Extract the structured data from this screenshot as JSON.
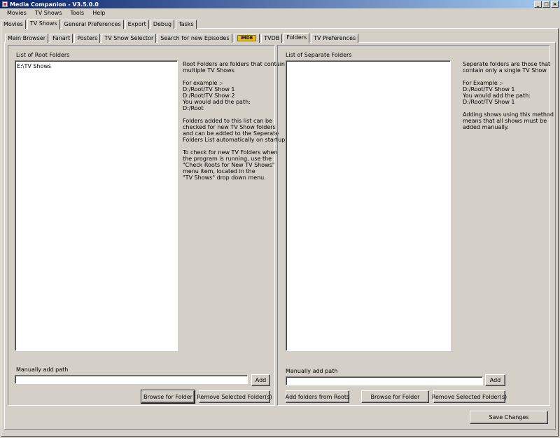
{
  "window": {
    "title": "Media Companion - V3.5.0.0"
  },
  "menu": [
    "Movies",
    "TV Shows",
    "Tools",
    "Help"
  ],
  "main_tabs": [
    "Movies",
    "TV Shows",
    "General Preferences",
    "Export",
    "Debug",
    "Tasks"
  ],
  "active_main_tab": "TV Shows",
  "sub_tabs": [
    "Main Browser",
    "Fanart",
    "Posters",
    "TV Show Selector",
    "Search for new Episodes",
    "IMDB",
    "TVDB",
    "Folders",
    "TV Preferences"
  ],
  "active_sub_tab": "Folders",
  "root_panel": {
    "list_label": "List of Root Folders",
    "items": [
      "E:\\TV Shows"
    ],
    "help_paragraphs": [
      [
        "Root Folders are folders that contain",
        "multiple TV Shows"
      ],
      [
        "For example :-",
        "D:/Root/TV Show 1",
        "D:/Root/TV Show 2",
        "You would add the path:",
        "D:/Root"
      ],
      [
        "Folders added to this list can be",
        "checked for new TV Show folders",
        "and can be added to the Seperate",
        "Folders List automatically on startup."
      ],
      [
        "To check for new TV Folders when",
        "the program is running, use the",
        "\"Check Roots for New TV Shows\"",
        "menu item, located in the",
        "\"TV Shows\" drop down menu."
      ]
    ],
    "manual_label": "Manually add path",
    "manual_value": "",
    "add_button": "Add",
    "browse_button": "Browse for Folder",
    "remove_button": "Remove Selected Folder(s)"
  },
  "separate_panel": {
    "list_label": "List of Separate Folders",
    "items": [],
    "help_paragraphs": [
      [
        "Seperate folders are those that",
        "contain only a single TV Show"
      ],
      [
        "For Example :-",
        "D:/Root/TV Show 1",
        "You would add the path:",
        "D:/Root/TV Show 1"
      ],
      [
        "Adding shows using this method",
        "means that all shows must be",
        "added manually."
      ]
    ],
    "manual_label": "Manually add path",
    "manual_value": "",
    "add_button": "Add",
    "add_from_roots_button": "Add folders from Roots",
    "browse_button": "Browse for Folder",
    "remove_button": "Remove Selected Folder(s)"
  },
  "save_button": "Save Changes"
}
